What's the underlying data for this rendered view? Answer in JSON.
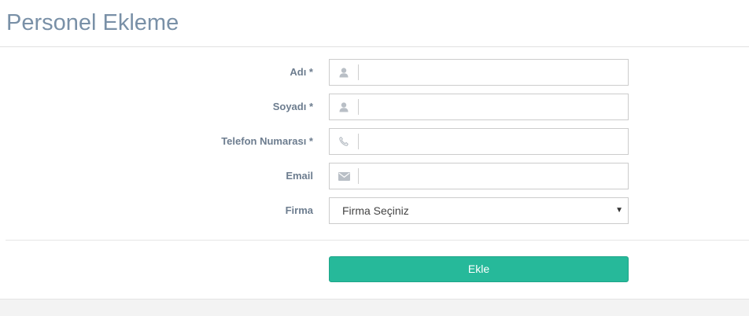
{
  "page": {
    "title": "Personel Ekleme"
  },
  "form": {
    "fields": [
      {
        "label": "Adı *",
        "icon": "user-icon",
        "value": ""
      },
      {
        "label": "Soyadı *",
        "icon": "user-icon",
        "value": ""
      },
      {
        "label": "Telefon Numarası *",
        "icon": "phone-icon",
        "value": ""
      },
      {
        "label": "Email",
        "icon": "envelope-icon",
        "value": ""
      }
    ],
    "company": {
      "label": "Firma",
      "selected": "Firma Seçiniz",
      "caret": "▼"
    },
    "submit_label": "Ekle"
  },
  "colors": {
    "title": "#7990a7",
    "label": "#6d7d8f",
    "accent": "#26b99a",
    "icon": "#b9bfc6"
  }
}
